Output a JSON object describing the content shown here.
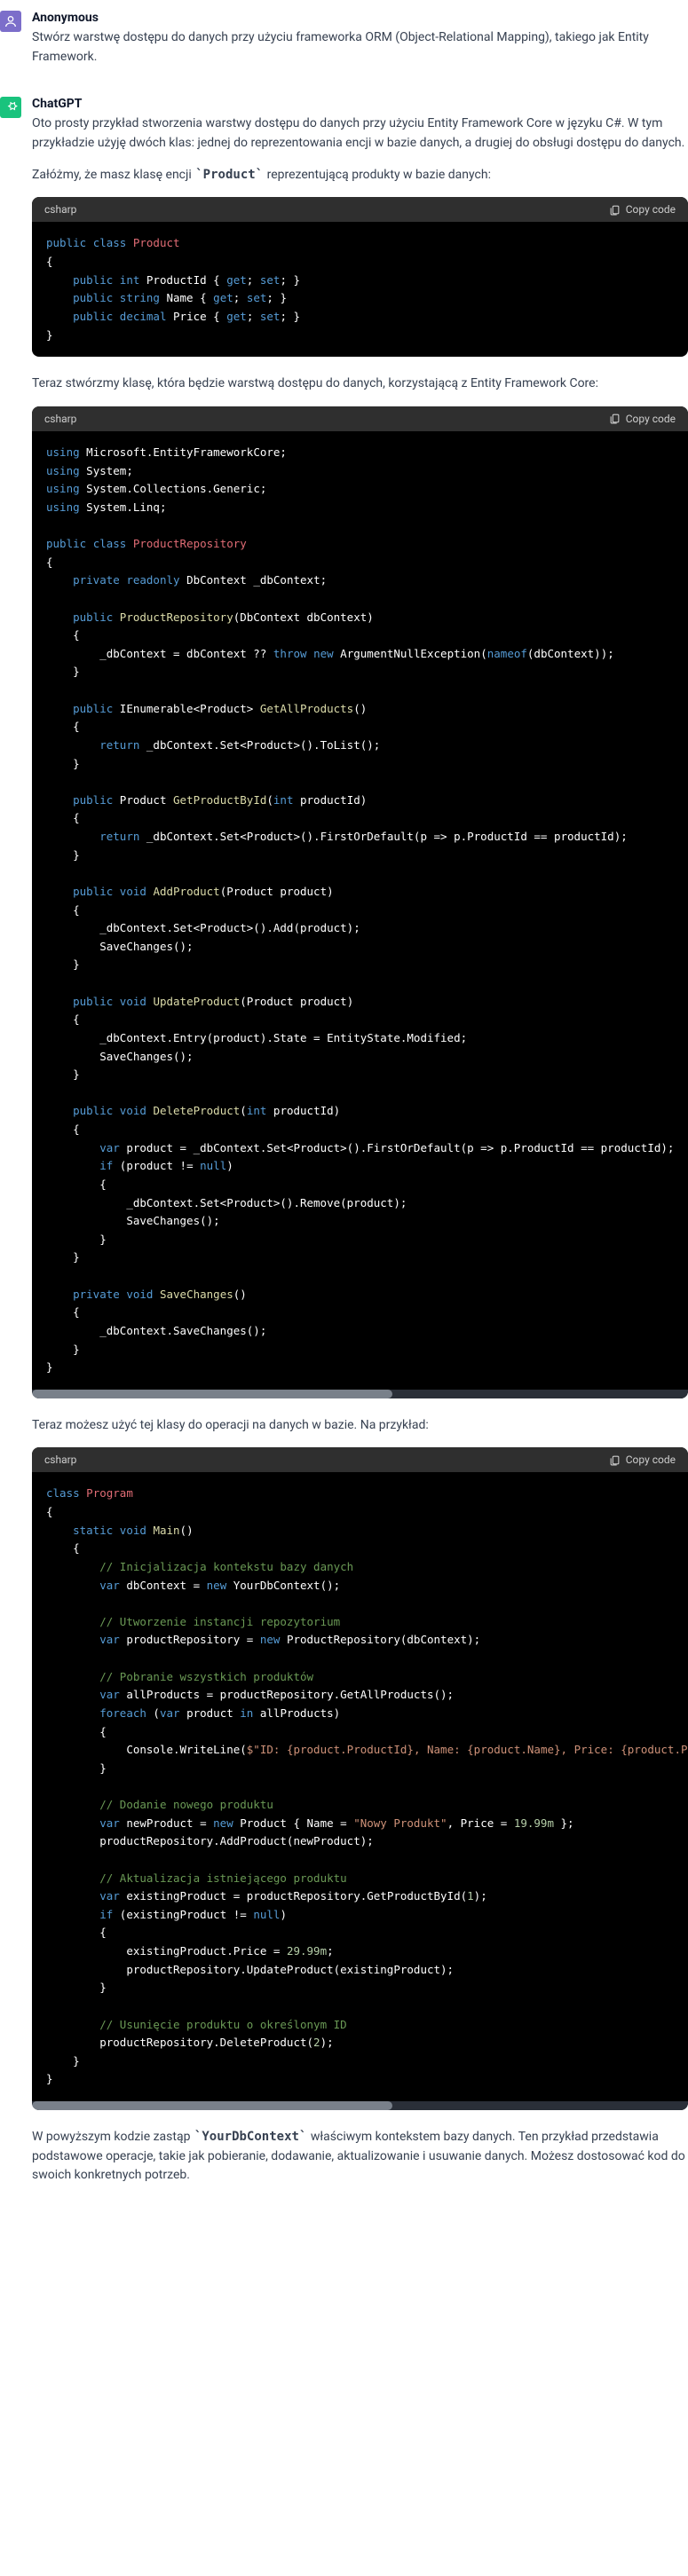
{
  "users": {
    "anon": "Anonymous",
    "gpt": "ChatGPT"
  },
  "user_prompt": "Stwórz warstwę dostępu do danych przy użyciu frameworka ORM (Object-Relational Mapping), takiego jak Entity Framework.",
  "p1": "Oto prosty przykład stworzenia warstwy dostępu do danych przy użyciu Entity Framework Core w języku C#. W tym przykładzie użyję dwóch klas: jednej do reprezentowania encji w bazie danych, a drugiej do obsługi dostępu do danych.",
  "p2_pre": "Załóżmy, że masz klasę encji ",
  "p2_code": "Product",
  "p2_post": " reprezentującą produkty w bazie danych:",
  "p3": "Teraz stwórzmy klasę, która będzie warstwą dostępu do danych, korzystającą z Entity Framework Core:",
  "p4": "Teraz możesz użyć tej klasy do operacji na danych w bazie. Na przykład:",
  "p5_pre": "W powyższym kodzie zastąp ",
  "p5_code": "YourDbContext",
  "p5_post": " właściwym kontekstem bazy danych. Ten przykład przedstawia podstawowe operacje, takie jak pobieranie, dodawanie, aktualizowanie i usuwanie danych. Możesz dostosować kod do swoich konkretnych potrzeb.",
  "lang": "csharp",
  "copy": "Copy code",
  "code1": {
    "l1": {
      "a": "public",
      "b": "class",
      "c": "Product"
    },
    "l2": "{",
    "l3": {
      "a": "public",
      "b": "int",
      "c": "ProductId",
      "d": "get",
      "e": "set"
    },
    "l4": {
      "a": "public",
      "b": "string",
      "c": "Name",
      "d": "get",
      "e": "set"
    },
    "l5": {
      "a": "public",
      "b": "decimal",
      "c": "Price",
      "d": "get",
      "e": "set"
    },
    "l6": "}"
  },
  "code2": {
    "u1": {
      "a": "using",
      "b": "Microsoft.EntityFrameworkCore;"
    },
    "u2": {
      "a": "using",
      "b": "System;"
    },
    "u3": {
      "a": "using",
      "b": "System.Collections.Generic;"
    },
    "u4": {
      "a": "using",
      "b": "System.Linq;"
    },
    "cls": {
      "a": "public",
      "b": "class",
      "c": "ProductRepository"
    },
    "ob": "{",
    "cb": "}",
    "fld": {
      "a": "private",
      "b": "readonly",
      "c": "DbContext _dbContext;"
    },
    "ctor": {
      "a": "public",
      "b": "ProductRepository",
      "c": "(DbContext dbContext)"
    },
    "ctorbody": {
      "a": "_dbContext = dbContext ?? ",
      "b": "throw",
      "c": "new",
      "d": "ArgumentNullException(",
      "e": "nameof",
      "f": "(dbContext));"
    },
    "gap": {
      "a": "public",
      "b": "IEnumerable<Product>",
      "c": "GetAllProducts",
      "d": "()"
    },
    "gapbody": {
      "a": "return",
      "b": " _dbContext.Set<Product>().ToList();"
    },
    "gbi": {
      "a": "public",
      "b": "Product ",
      "c": "GetProductById",
      "d": "(",
      "e": "int",
      "f": " productId)"
    },
    "gbibody": {
      "a": "return",
      "b": " _dbContext.Set<Product>().FirstOrDefault(p => p.ProductId == productId);"
    },
    "add": {
      "a": "public",
      "b": "void",
      "c": "AddProduct",
      "d": "(Product product)"
    },
    "addbody1": "_dbContext.Set<Product>().Add(product);",
    "addbody2": "SaveChanges();",
    "upd": {
      "a": "public",
      "b": "void",
      "c": "UpdateProduct",
      "d": "(Product product)"
    },
    "updbody1": "_dbContext.Entry(product).State = EntityState.Modified;",
    "updbody2": "SaveChanges();",
    "del": {
      "a": "public",
      "b": "void",
      "c": "DeleteProduct",
      "d": "(",
      "e": "int",
      "f": " productId)"
    },
    "delbody1": {
      "a": "var",
      "b": " product = _dbContext.Set<Product>().FirstOrDefault(p => p.ProductId == productId);"
    },
    "delbody2": {
      "a": "if",
      "b": " (product != ",
      "c": "null",
      "d": ")"
    },
    "delbody3": "_dbContext.Set<Product>().Remove(product);",
    "delbody4": "SaveChanges();",
    "save": {
      "a": "private",
      "b": "void",
      "c": "SaveChanges",
      "d": "()"
    },
    "savebody": "_dbContext.SaveChanges();"
  },
  "code3": {
    "cls": {
      "a": "class",
      "b": "Program"
    },
    "ob": "{",
    "cb": "}",
    "main": {
      "a": "static",
      "b": "void",
      "c": "Main",
      "d": "()"
    },
    "c1": "// Inicjalizacja kontekstu bazy danych",
    "l1": {
      "a": "var",
      "b": " dbContext = ",
      "c": "new",
      "d": " YourDbContext();"
    },
    "c2": "// Utworzenie instancji repozytorium",
    "l2": {
      "a": "var",
      "b": " productRepository = ",
      "c": "new",
      "d": " ProductRepository(dbContext);"
    },
    "c3": "// Pobranie wszystkich produktów",
    "l3": {
      "a": "var",
      "b": " allProducts = productRepository.GetAllProducts();"
    },
    "l4": {
      "a": "foreach",
      "b": " (",
      "c": "var",
      "d": " product ",
      "e": "in",
      "f": " allProducts)"
    },
    "l5": {
      "a": "Console.WriteLine(",
      "b": "$\"ID: ",
      "c": "{product.ProductId}",
      "d": ", Name: ",
      "e": "{product.Name}",
      "f": ", Price: ",
      "g": "{product.Price}",
      "h": "\"",
      ");": ");"
    },
    "c4": "// Dodanie nowego produktu",
    "l6": {
      "a": "var",
      "b": " newProduct = ",
      "c": "new",
      "d": " Product { Name = ",
      "e": "\"Nowy Produkt\"",
      "f": ", Price = ",
      "g": "19.99m",
      "h": " };"
    },
    "l7": "productRepository.AddProduct(newProduct);",
    "c5": "// Aktualizacja istniejącego produktu",
    "l8": {
      "a": "var",
      "b": " existingProduct = productRepository.GetProductById(",
      "c": "1",
      "d": ");"
    },
    "l9": {
      "a": "if",
      "b": " (existingProduct != ",
      "c": "null",
      "d": ")"
    },
    "l10": {
      "a": "existingProduct.Price = ",
      "b": "29.99m",
      "c": ";"
    },
    "l11": "productRepository.UpdateProduct(existingProduct);",
    "c6": "// Usunięcie produktu o określonym ID",
    "l12": {
      "a": "productRepository.DeleteProduct(",
      "b": "2",
      "c": ");"
    }
  }
}
